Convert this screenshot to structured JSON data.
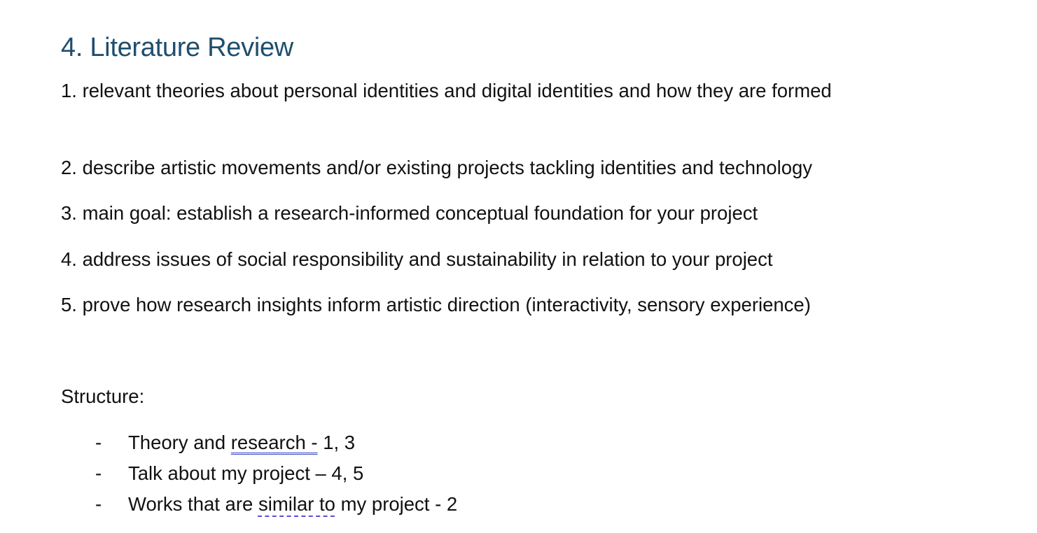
{
  "heading": "4. Literature Review",
  "heading_color": "#1f4e6e",
  "points": [
    "1. relevant theories about personal identities and digital identities and how they are formed",
    "2.  describe artistic movements and/or existing projects tackling identities and technology",
    "3. main goal: establish a research-informed conceptual foundation for your project",
    "4. address issues of social responsibility and sustainability in relation to your project",
    "5. prove how research insights inform artistic direction (interactivity, sensory experience)"
  ],
  "structure_label": "Structure:",
  "structure_items": [
    {
      "dash": "-",
      "prefix": "Theory and ",
      "marked": "research  -",
      "suffix": " 1, 3",
      "mark_style": "double-underline"
    },
    {
      "dash": "-",
      "text": "Talk about my project – 4, 5"
    },
    {
      "dash": "-",
      "prefix": "Works that are ",
      "marked": "similar to",
      "suffix": " my project - 2",
      "mark_style": "dashed-underline"
    }
  ]
}
